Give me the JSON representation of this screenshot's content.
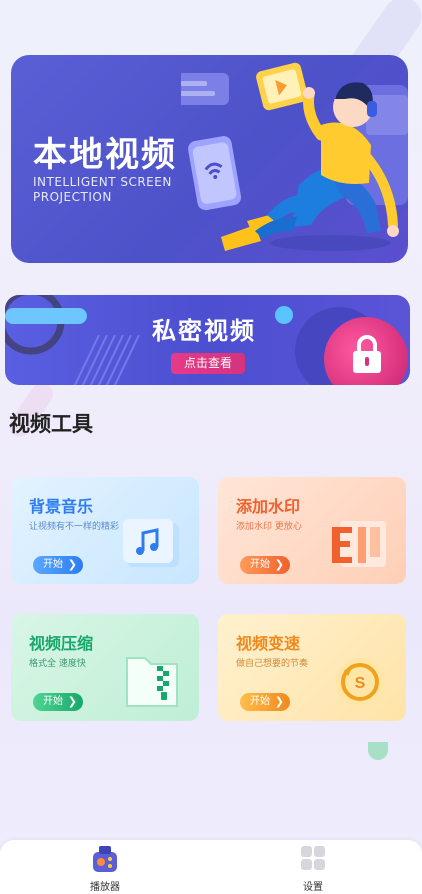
{
  "hero": {
    "title": "本地视频",
    "subtitle": "INTELLIGENT SCREEN PROJECTION"
  },
  "private_banner": {
    "title": "私密视频",
    "button_label": "点击查看"
  },
  "tools_section": {
    "title": "视频工具"
  },
  "tools": [
    {
      "title": "背景音乐",
      "desc": "让视频有不一样的精彩",
      "button": "开始",
      "title_color": "#2d7df0",
      "icon": "music-note-icon"
    },
    {
      "title": "添加水印",
      "desc": "添加水印 更放心",
      "button": "开始",
      "title_color": "#f0612d",
      "icon": "watermark-stamp-icon"
    },
    {
      "title": "视频压缩",
      "desc": "格式全 速度快",
      "button": "开始",
      "title_color": "#18a86b",
      "icon": "zip-file-icon"
    },
    {
      "title": "视频变速",
      "desc": "做自己想要的节奏",
      "button": "开始",
      "title_color": "#f08a1e",
      "icon": "speed-coin-icon"
    }
  ],
  "bottom_nav": {
    "items": [
      {
        "label": "播放器",
        "icon": "player-camera-icon"
      },
      {
        "label": "设置",
        "icon": "settings-grid-icon"
      }
    ]
  },
  "colors": {
    "hero_bg": "#5055cc",
    "accent_pink": "#e63a88"
  }
}
